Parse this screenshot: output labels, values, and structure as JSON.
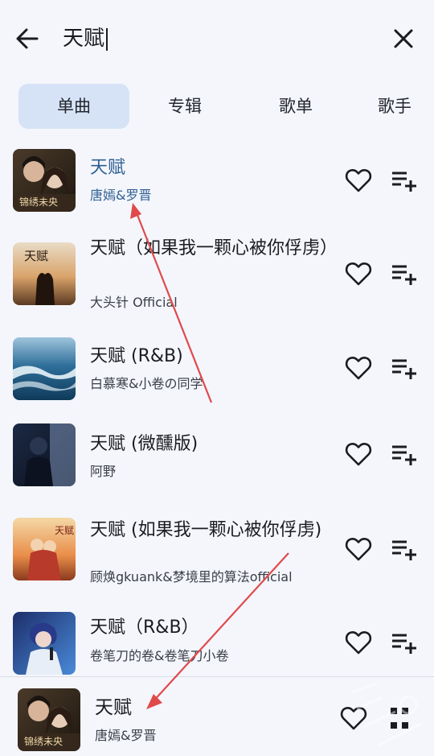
{
  "search": {
    "query": "天赋"
  },
  "tabs": [
    {
      "label": "单曲",
      "active": true
    },
    {
      "label": "专辑",
      "active": false
    },
    {
      "label": "歌单",
      "active": false
    },
    {
      "label": "歌手",
      "active": false
    }
  ],
  "songs": [
    {
      "title": "天赋",
      "artist": "唐嫣&罗晋",
      "playing": true,
      "cover": "drama-couple-cover"
    },
    {
      "title": "天赋（如果我一颗心被你俘虏）",
      "artist": "大头针 Official",
      "playing": false,
      "cover": "sunset-silhouette-cover"
    },
    {
      "title": "天赋 (R&B)",
      "artist": "白慕寒&小卷の同学",
      "playing": false,
      "cover": "ocean-waves-cover"
    },
    {
      "title": "天赋 (微醺版)",
      "artist": "阿野",
      "playing": false,
      "cover": "dark-portrait-cover"
    },
    {
      "title": "天赋 (如果我一颗心被你俘虏)",
      "artist": "顾焕gkuank&梦境里的算法official",
      "playing": false,
      "cover": "painted-lovers-cover"
    },
    {
      "title": "天赋（R&B）",
      "artist": "卷笔刀的卷&卷笔刀小卷",
      "playing": false,
      "cover": "anime-singer-cover"
    }
  ],
  "now_playing": {
    "title": "天赋",
    "artist": "唐嫣&罗晋"
  },
  "icons": {
    "back": "arrow-left-icon",
    "close": "close-icon",
    "favorite": "heart-outline-icon",
    "add_to_queue": "playlist-add-icon",
    "expand": "expand-icon"
  },
  "colors": {
    "background": "#f4f6fc",
    "active_tab": "#d6e3f6",
    "playing_text": "#2f5f92",
    "annotation_arrow": "#e04a4a"
  }
}
